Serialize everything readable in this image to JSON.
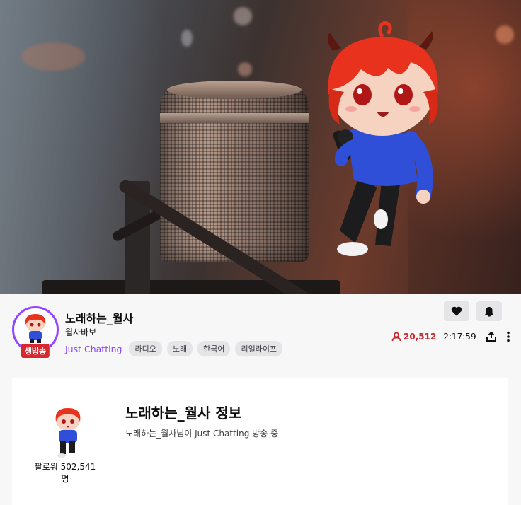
{
  "stream": {
    "title": "노래하는_월사",
    "channel_name": "월사바보",
    "category": "Just Chatting",
    "tags": [
      "라디오",
      "노래",
      "한국어",
      "리얼라이프"
    ],
    "live_badge": "생방송",
    "viewer_count": "20,512",
    "uptime": "2:17:59"
  },
  "about": {
    "title": "노래하는_월사 정보",
    "subtitle": "노래하는_월사님이 Just Chatting 방송 중",
    "followers": "팔로워 502,541 명"
  },
  "icons": {
    "heart": "heart-icon",
    "bell": "bell-icon",
    "viewers": "person-icon",
    "share": "share-icon",
    "more": "more-vertical-icon"
  },
  "colors": {
    "accent": "#9147ff",
    "live": "#d6282f",
    "viewer_count": "#c9262d"
  }
}
